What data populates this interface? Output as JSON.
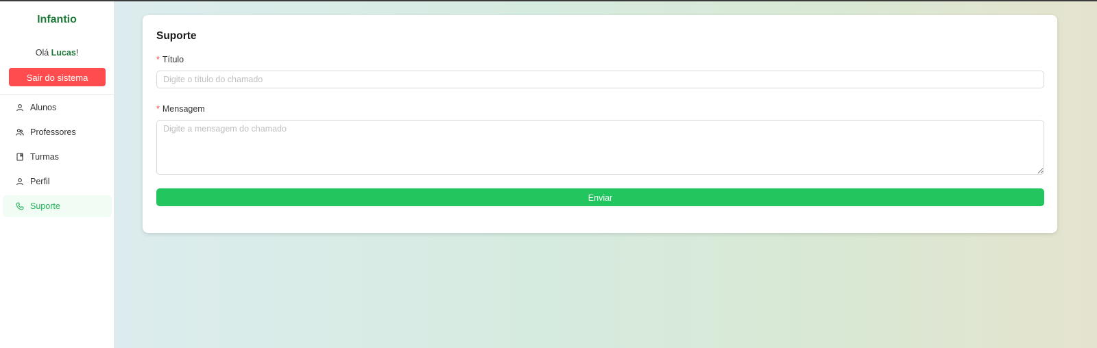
{
  "app": {
    "brand": "Infantio"
  },
  "user": {
    "greeting_prefix": "Olá ",
    "name": "Lucas",
    "greeting_suffix": "!",
    "logout_label": "Sair do sistema"
  },
  "sidebar": {
    "items": [
      {
        "label": "Alunos",
        "icon": "user-icon",
        "active": false
      },
      {
        "label": "Professores",
        "icon": "users-icon",
        "active": false
      },
      {
        "label": "Turmas",
        "icon": "book-icon",
        "active": false
      },
      {
        "label": "Perfil",
        "icon": "user-icon",
        "active": false
      },
      {
        "label": "Suporte",
        "icon": "phone-icon",
        "active": true
      }
    ]
  },
  "form": {
    "title": "Suporte",
    "title_field": {
      "required_mark": "*",
      "label": "Título",
      "placeholder": "Digite o título do chamado",
      "value": ""
    },
    "message_field": {
      "required_mark": "*",
      "label": "Mensagem",
      "placeholder": "Digite a mensagem do chamado",
      "value": ""
    },
    "submit_label": "Enviar"
  },
  "colors": {
    "brand": "#1f7a3a",
    "danger": "#ff4d4f",
    "primary": "#22c55e",
    "active_nav_bg": "#f0fcf4"
  }
}
